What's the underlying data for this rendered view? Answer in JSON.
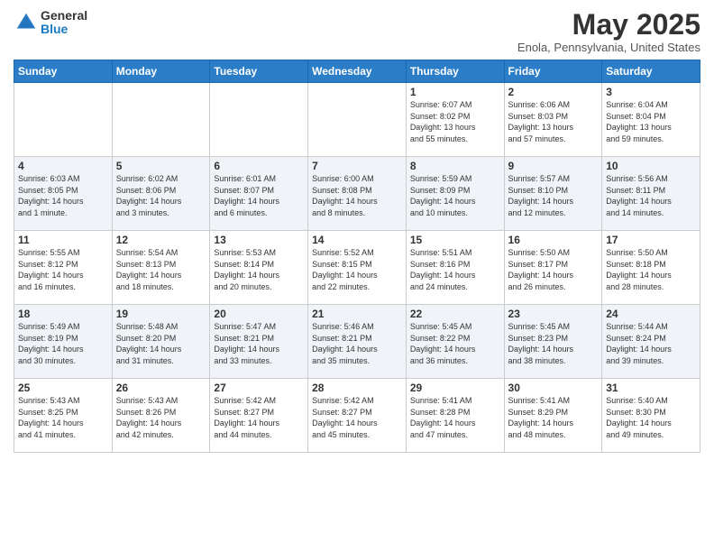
{
  "logo": {
    "general": "General",
    "blue": "Blue"
  },
  "title": "May 2025",
  "subtitle": "Enola, Pennsylvania, United States",
  "days_header": [
    "Sunday",
    "Monday",
    "Tuesday",
    "Wednesday",
    "Thursday",
    "Friday",
    "Saturday"
  ],
  "weeks": [
    [
      {
        "day": "",
        "info": ""
      },
      {
        "day": "",
        "info": ""
      },
      {
        "day": "",
        "info": ""
      },
      {
        "day": "",
        "info": ""
      },
      {
        "day": "1",
        "info": "Sunrise: 6:07 AM\nSunset: 8:02 PM\nDaylight: 13 hours\nand 55 minutes."
      },
      {
        "day": "2",
        "info": "Sunrise: 6:06 AM\nSunset: 8:03 PM\nDaylight: 13 hours\nand 57 minutes."
      },
      {
        "day": "3",
        "info": "Sunrise: 6:04 AM\nSunset: 8:04 PM\nDaylight: 13 hours\nand 59 minutes."
      }
    ],
    [
      {
        "day": "4",
        "info": "Sunrise: 6:03 AM\nSunset: 8:05 PM\nDaylight: 14 hours\nand 1 minute."
      },
      {
        "day": "5",
        "info": "Sunrise: 6:02 AM\nSunset: 8:06 PM\nDaylight: 14 hours\nand 3 minutes."
      },
      {
        "day": "6",
        "info": "Sunrise: 6:01 AM\nSunset: 8:07 PM\nDaylight: 14 hours\nand 6 minutes."
      },
      {
        "day": "7",
        "info": "Sunrise: 6:00 AM\nSunset: 8:08 PM\nDaylight: 14 hours\nand 8 minutes."
      },
      {
        "day": "8",
        "info": "Sunrise: 5:59 AM\nSunset: 8:09 PM\nDaylight: 14 hours\nand 10 minutes."
      },
      {
        "day": "9",
        "info": "Sunrise: 5:57 AM\nSunset: 8:10 PM\nDaylight: 14 hours\nand 12 minutes."
      },
      {
        "day": "10",
        "info": "Sunrise: 5:56 AM\nSunset: 8:11 PM\nDaylight: 14 hours\nand 14 minutes."
      }
    ],
    [
      {
        "day": "11",
        "info": "Sunrise: 5:55 AM\nSunset: 8:12 PM\nDaylight: 14 hours\nand 16 minutes."
      },
      {
        "day": "12",
        "info": "Sunrise: 5:54 AM\nSunset: 8:13 PM\nDaylight: 14 hours\nand 18 minutes."
      },
      {
        "day": "13",
        "info": "Sunrise: 5:53 AM\nSunset: 8:14 PM\nDaylight: 14 hours\nand 20 minutes."
      },
      {
        "day": "14",
        "info": "Sunrise: 5:52 AM\nSunset: 8:15 PM\nDaylight: 14 hours\nand 22 minutes."
      },
      {
        "day": "15",
        "info": "Sunrise: 5:51 AM\nSunset: 8:16 PM\nDaylight: 14 hours\nand 24 minutes."
      },
      {
        "day": "16",
        "info": "Sunrise: 5:50 AM\nSunset: 8:17 PM\nDaylight: 14 hours\nand 26 minutes."
      },
      {
        "day": "17",
        "info": "Sunrise: 5:50 AM\nSunset: 8:18 PM\nDaylight: 14 hours\nand 28 minutes."
      }
    ],
    [
      {
        "day": "18",
        "info": "Sunrise: 5:49 AM\nSunset: 8:19 PM\nDaylight: 14 hours\nand 30 minutes."
      },
      {
        "day": "19",
        "info": "Sunrise: 5:48 AM\nSunset: 8:20 PM\nDaylight: 14 hours\nand 31 minutes."
      },
      {
        "day": "20",
        "info": "Sunrise: 5:47 AM\nSunset: 8:21 PM\nDaylight: 14 hours\nand 33 minutes."
      },
      {
        "day": "21",
        "info": "Sunrise: 5:46 AM\nSunset: 8:21 PM\nDaylight: 14 hours\nand 35 minutes."
      },
      {
        "day": "22",
        "info": "Sunrise: 5:45 AM\nSunset: 8:22 PM\nDaylight: 14 hours\nand 36 minutes."
      },
      {
        "day": "23",
        "info": "Sunrise: 5:45 AM\nSunset: 8:23 PM\nDaylight: 14 hours\nand 38 minutes."
      },
      {
        "day": "24",
        "info": "Sunrise: 5:44 AM\nSunset: 8:24 PM\nDaylight: 14 hours\nand 39 minutes."
      }
    ],
    [
      {
        "day": "25",
        "info": "Sunrise: 5:43 AM\nSunset: 8:25 PM\nDaylight: 14 hours\nand 41 minutes."
      },
      {
        "day": "26",
        "info": "Sunrise: 5:43 AM\nSunset: 8:26 PM\nDaylight: 14 hours\nand 42 minutes."
      },
      {
        "day": "27",
        "info": "Sunrise: 5:42 AM\nSunset: 8:27 PM\nDaylight: 14 hours\nand 44 minutes."
      },
      {
        "day": "28",
        "info": "Sunrise: 5:42 AM\nSunset: 8:27 PM\nDaylight: 14 hours\nand 45 minutes."
      },
      {
        "day": "29",
        "info": "Sunrise: 5:41 AM\nSunset: 8:28 PM\nDaylight: 14 hours\nand 47 minutes."
      },
      {
        "day": "30",
        "info": "Sunrise: 5:41 AM\nSunset: 8:29 PM\nDaylight: 14 hours\nand 48 minutes."
      },
      {
        "day": "31",
        "info": "Sunrise: 5:40 AM\nSunset: 8:30 PM\nDaylight: 14 hours\nand 49 minutes."
      }
    ]
  ]
}
